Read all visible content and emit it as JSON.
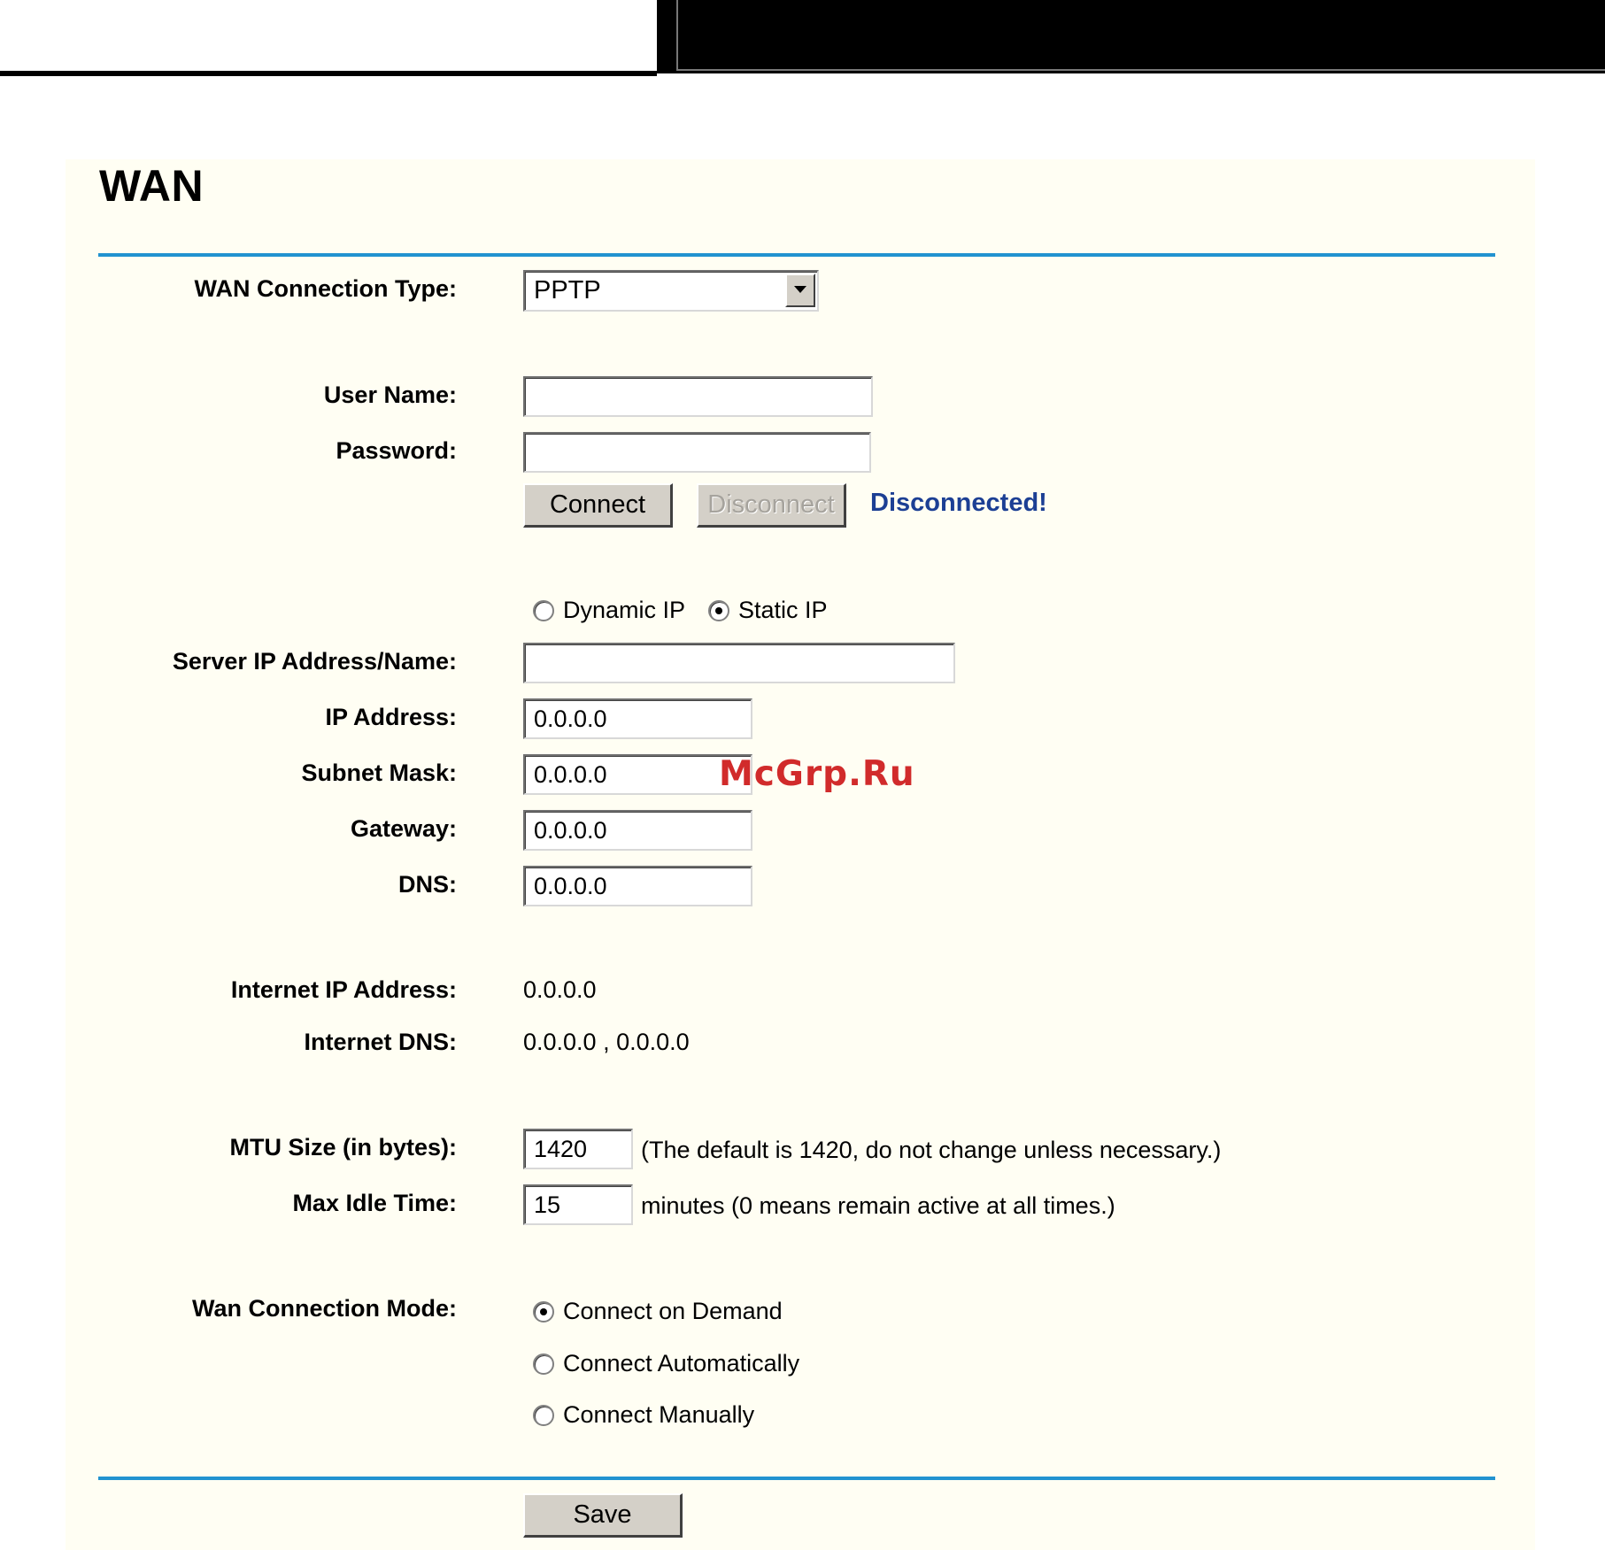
{
  "page": {
    "title": "WAN"
  },
  "connection_type": {
    "label": "WAN Connection Type:",
    "value": "PPTP"
  },
  "credentials": {
    "user_name_label": "User Name:",
    "user_name_value": "",
    "password_label": "Password:",
    "password_value": ""
  },
  "actions": {
    "connect_label": "Connect",
    "disconnect_label": "Disconnect",
    "status_text": "Disconnected!"
  },
  "ip_mode": {
    "dynamic_label": "Dynamic IP",
    "static_label": "Static IP",
    "selected": "static"
  },
  "static_fields": {
    "server_label": "Server IP Address/Name:",
    "server_value": "",
    "ip_label": "IP Address:",
    "ip_value": "0.0.0.0",
    "mask_label": "Subnet Mask:",
    "mask_value": "0.0.0.0",
    "gateway_label": "Gateway:",
    "gateway_value": "0.0.0.0",
    "dns_label": "DNS:",
    "dns_value": "0.0.0.0"
  },
  "internet": {
    "ip_label": "Internet IP Address:",
    "ip_value": "0.0.0.0",
    "dns_label": "Internet DNS:",
    "dns_value": "0.0.0.0 , 0.0.0.0"
  },
  "mtu": {
    "label": "MTU Size (in bytes):",
    "value": "1420",
    "note": "(The default is 1420, do not change unless necessary.)"
  },
  "idle": {
    "label": "Max Idle Time:",
    "value": "15",
    "note": "minutes (0 means remain active at all times.)"
  },
  "mode": {
    "label": "Wan Connection Mode:",
    "on_demand": "Connect on Demand",
    "automatic": "Connect Automatically",
    "manual": "Connect Manually",
    "selected": "on_demand"
  },
  "save_label": "Save",
  "watermark": "McGrp.Ru"
}
